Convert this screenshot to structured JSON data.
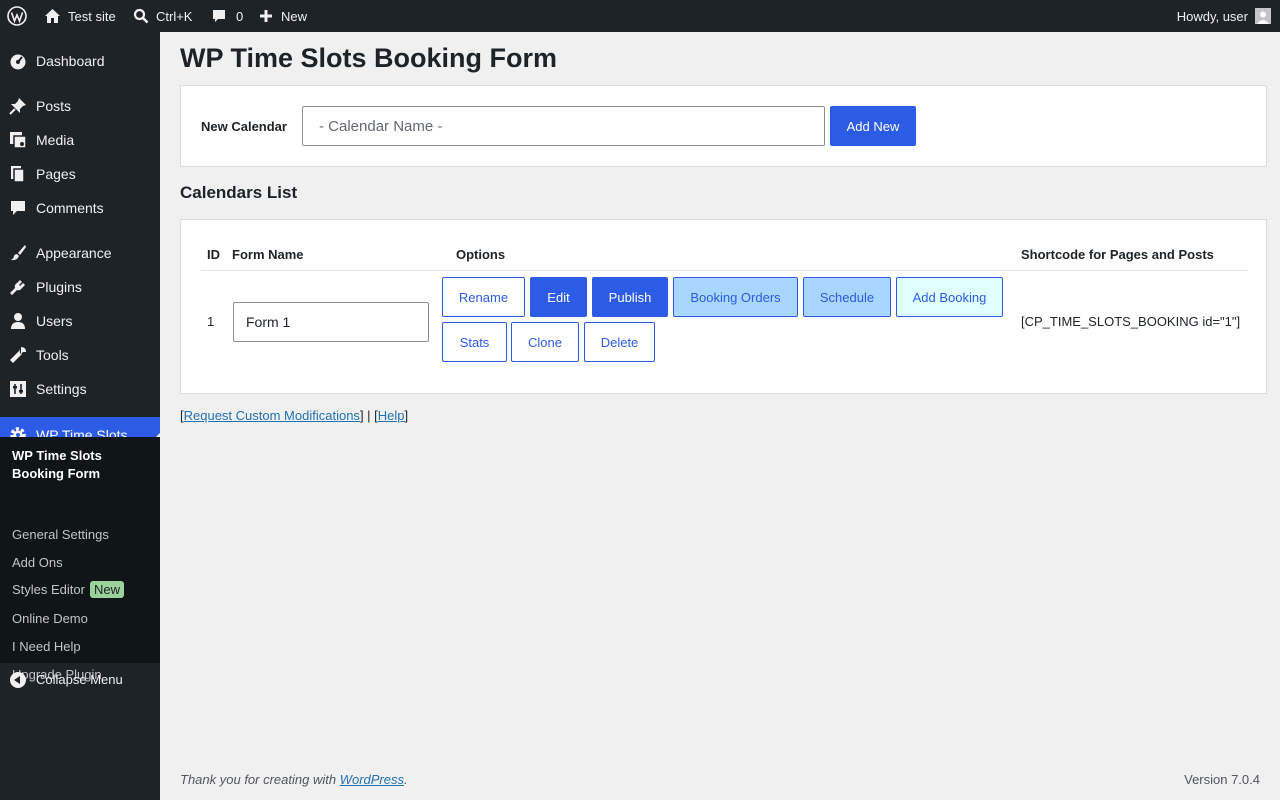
{
  "admin_bar": {
    "site_name": "Test site",
    "search_shortcut": "Ctrl+K",
    "comments_count": "0",
    "new_label": "New",
    "howdy": "Howdy, user"
  },
  "sidebar": {
    "items": [
      {
        "label": "Dashboard",
        "icon": "dashboard-icon"
      },
      {
        "label": "Posts",
        "icon": "pin-icon"
      },
      {
        "label": "Media",
        "icon": "media-icon"
      },
      {
        "label": "Pages",
        "icon": "pages-icon"
      },
      {
        "label": "Comments",
        "icon": "comment-icon"
      },
      {
        "label": "Appearance",
        "icon": "brush-icon"
      },
      {
        "label": "Plugins",
        "icon": "plug-icon"
      },
      {
        "label": "Users",
        "icon": "user-icon"
      },
      {
        "label": "Tools",
        "icon": "wrench-icon"
      },
      {
        "label": "Settings",
        "icon": "settings-icon"
      }
    ],
    "current": {
      "label": "WP Time Slots Booking Form",
      "icon": "gear-icon"
    },
    "submenu": [
      {
        "label": "WP Time Slots Booking Form"
      },
      {
        "label": "General Settings"
      },
      {
        "label": "Add Ons"
      },
      {
        "label": "Styles Editor",
        "badge": "New"
      },
      {
        "label": "Online Demo"
      },
      {
        "label": "I Need Help"
      },
      {
        "label": "Upgrade Plugin"
      }
    ],
    "collapse_label": "Collapse Menu"
  },
  "page": {
    "title": "WP Time Slots Booking Form",
    "new_calendar": {
      "label": "New Calendar",
      "placeholder": "- Calendar Name -",
      "button": "Add New"
    },
    "list_title": "Calendars List",
    "table": {
      "headers": [
        "ID",
        "Form Name",
        "Options",
        "Shortcode for Pages and Posts"
      ],
      "rows": [
        {
          "id": "1",
          "form_name": "Form 1",
          "options": [
            "Rename",
            "Edit",
            "Publish",
            "Booking Orders",
            "Schedule",
            "Add Booking",
            "Stats",
            "Clone",
            "Delete"
          ],
          "shortcode": "[CP_TIME_SLOTS_BOOKING id=\"1\"]"
        }
      ]
    },
    "links": {
      "custom": "Request Custom Modifications",
      "help": "Help"
    }
  },
  "footer": {
    "thanks_prefix": "Thank you for creating with ",
    "wordpress_link": "WordPress",
    "thanks_suffix": ".",
    "version": "Version 7.0.4"
  },
  "colors": {
    "accent": "#2c5be6",
    "admin_bg": "#1d2327",
    "submenu_bg": "#101517",
    "light_blue": "#a9d6ff",
    "cyan": "#e0ffff",
    "badge_green": "#9bd19b"
  }
}
